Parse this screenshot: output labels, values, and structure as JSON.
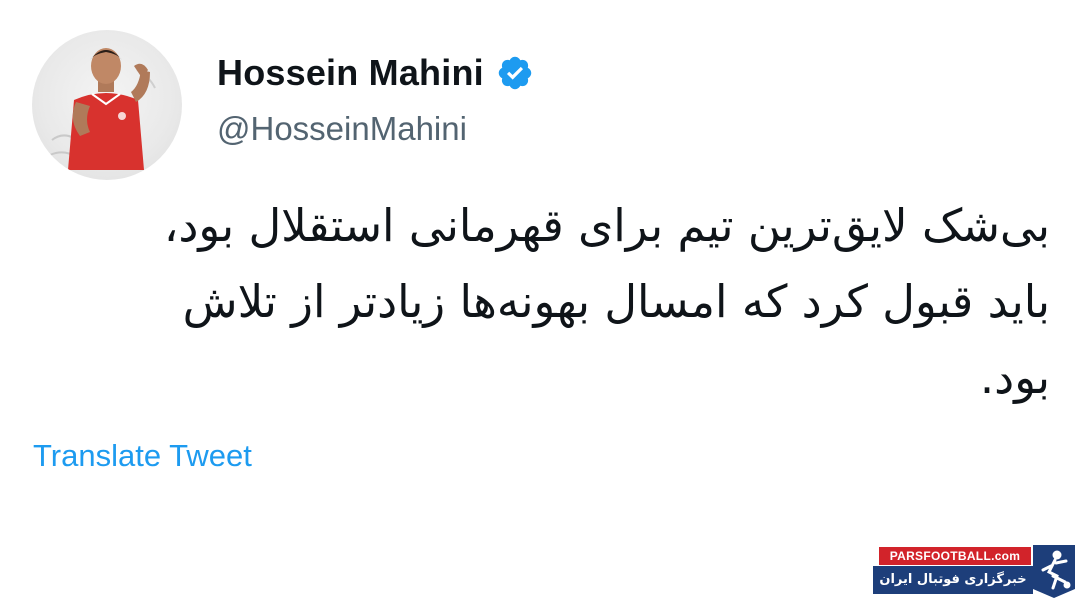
{
  "tweet": {
    "author": {
      "display_name": "Hossein Mahini",
      "handle": "@HosseinMahini",
      "verified": true,
      "avatar_icon": "profile-photo"
    },
    "text_lines": [
      "بی‌شک لایق‌ترین تیم برای قهرمانی استقلال بود،",
      "باید قبول کرد که امسال بهونه‌ها زیادتر از تلاش",
      "بود."
    ],
    "translate_label": "Translate Tweet"
  },
  "watermark": {
    "site": "PARSFOOTBALL.com",
    "tagline": "خبرگزاری فوتبال ایران",
    "emblem_icon": "player-kicking-icon"
  },
  "colors": {
    "text_primary": "#0f1419",
    "text_secondary": "#536471",
    "link": "#1d9bf0",
    "verified": "#1d9bf0",
    "watermark_red": "#d2232a",
    "watermark_blue": "#1d3e7a"
  }
}
